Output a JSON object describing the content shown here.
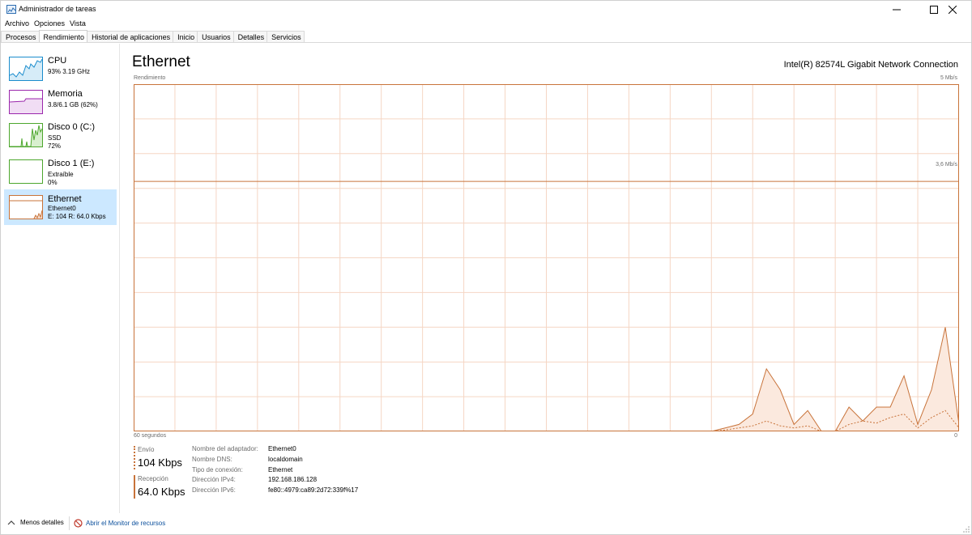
{
  "window": {
    "title": "Administrador de tareas",
    "controls": [
      "minimize",
      "maximize",
      "close"
    ]
  },
  "menu": [
    "Archivo",
    "Opciones",
    "Vista"
  ],
  "tabs": [
    "Procesos",
    "Rendimiento",
    "Historial de aplicaciones",
    "Inicio",
    "Usuarios",
    "Detalles",
    "Servicios"
  ],
  "active_tab": "Rendimiento",
  "sidebar": {
    "items": [
      {
        "name": "CPU",
        "line1": "93% 3.19 GHz",
        "line2": "",
        "line3": "",
        "color": "#1a8ccd"
      },
      {
        "name": "Memoria",
        "line1": "3.8/6.1 GB (62%)",
        "line2": "",
        "line3": "",
        "color": "#9b27ac"
      },
      {
        "name": "Disco 0 (C:)",
        "line1": "SSD",
        "line2": "72%",
        "line3": "",
        "color": "#4da72d"
      },
      {
        "name": "Disco 1 (E:)",
        "line1": "Extraíble",
        "line2": "0%",
        "line3": "",
        "color": "#4da72d"
      },
      {
        "name": "Ethernet",
        "line1": "Ethernet0",
        "line2": "E: 104 R: 64.0 Kbps",
        "line3": "",
        "color": "#c8733a"
      }
    ],
    "selected": "Ethernet"
  },
  "main": {
    "title": "Ethernet",
    "device": "Intel(R) 82574L Gigabit Network Connection",
    "graph_label": "Rendimiento",
    "max_label": "5 Mb/s",
    "mid_label": "3,6 Mb/s",
    "time_label": "60 segundos",
    "min_label": "0"
  },
  "stats": {
    "send_label": "Envío",
    "send_value": "104 Kbps",
    "recv_label": "Recepción",
    "recv_value": "64.0 Kbps"
  },
  "properties": [
    {
      "key": "Nombre del adaptador:",
      "value": "Ethernet0"
    },
    {
      "key": "Nombre DNS:",
      "value": "localdomain"
    },
    {
      "key": "Tipo de conexión:",
      "value": "Ethernet"
    },
    {
      "key": "Dirección IPv4:",
      "value": "192.168.186.128"
    },
    {
      "key": "Dirección IPv6:",
      "value": "fe80::4979:ca89:2d72:339f%17"
    }
  ],
  "footer": {
    "less_details": "Menos detalles",
    "open_monitor": "Abrir el Monitor de recursos"
  },
  "colors": {
    "ethernet_accent": "#c8733a",
    "grid_line": "#f5d6c4",
    "selected_bg": "#cce8ff"
  },
  "chart_data": {
    "type": "area",
    "title": "Rendimiento",
    "x_label": "60 segundos",
    "y_unit": "Mb/s",
    "ylim": [
      0,
      5
    ],
    "series": [
      {
        "name": "Recepción",
        "values": [
          0,
          0,
          0,
          0,
          0,
          0,
          0,
          0,
          0,
          0,
          0,
          0,
          0,
          0,
          0,
          0,
          0,
          0,
          0,
          0,
          0,
          0,
          0,
          0,
          0,
          0,
          0,
          0,
          0,
          0,
          0,
          0,
          0,
          0,
          0,
          0,
          0,
          0,
          0,
          0,
          0,
          0,
          0,
          0.05,
          0.1,
          0.25,
          0.9,
          0.6,
          0.1,
          0.3,
          0,
          0,
          0.35,
          0.15,
          0.35,
          0.35,
          0.8,
          0.1,
          0.6,
          1.5,
          0.1
        ]
      },
      {
        "name": "Envío",
        "values": [
          0,
          0,
          0,
          0,
          0,
          0,
          0,
          0,
          0,
          0,
          0,
          0,
          0,
          0,
          0,
          0,
          0,
          0,
          0,
          0,
          0,
          0,
          0,
          0,
          0,
          0,
          0,
          0,
          0,
          0,
          0,
          0,
          0,
          0,
          0,
          0,
          0,
          0,
          0,
          0,
          0,
          0,
          0,
          0.02,
          0.05,
          0.08,
          0.15,
          0.08,
          0.05,
          0.08,
          0,
          0,
          0.1,
          0.15,
          0.12,
          0.2,
          0.25,
          0.05,
          0.2,
          0.3,
          0.05
        ]
      }
    ],
    "reference_line": 3.6,
    "grid": true
  }
}
